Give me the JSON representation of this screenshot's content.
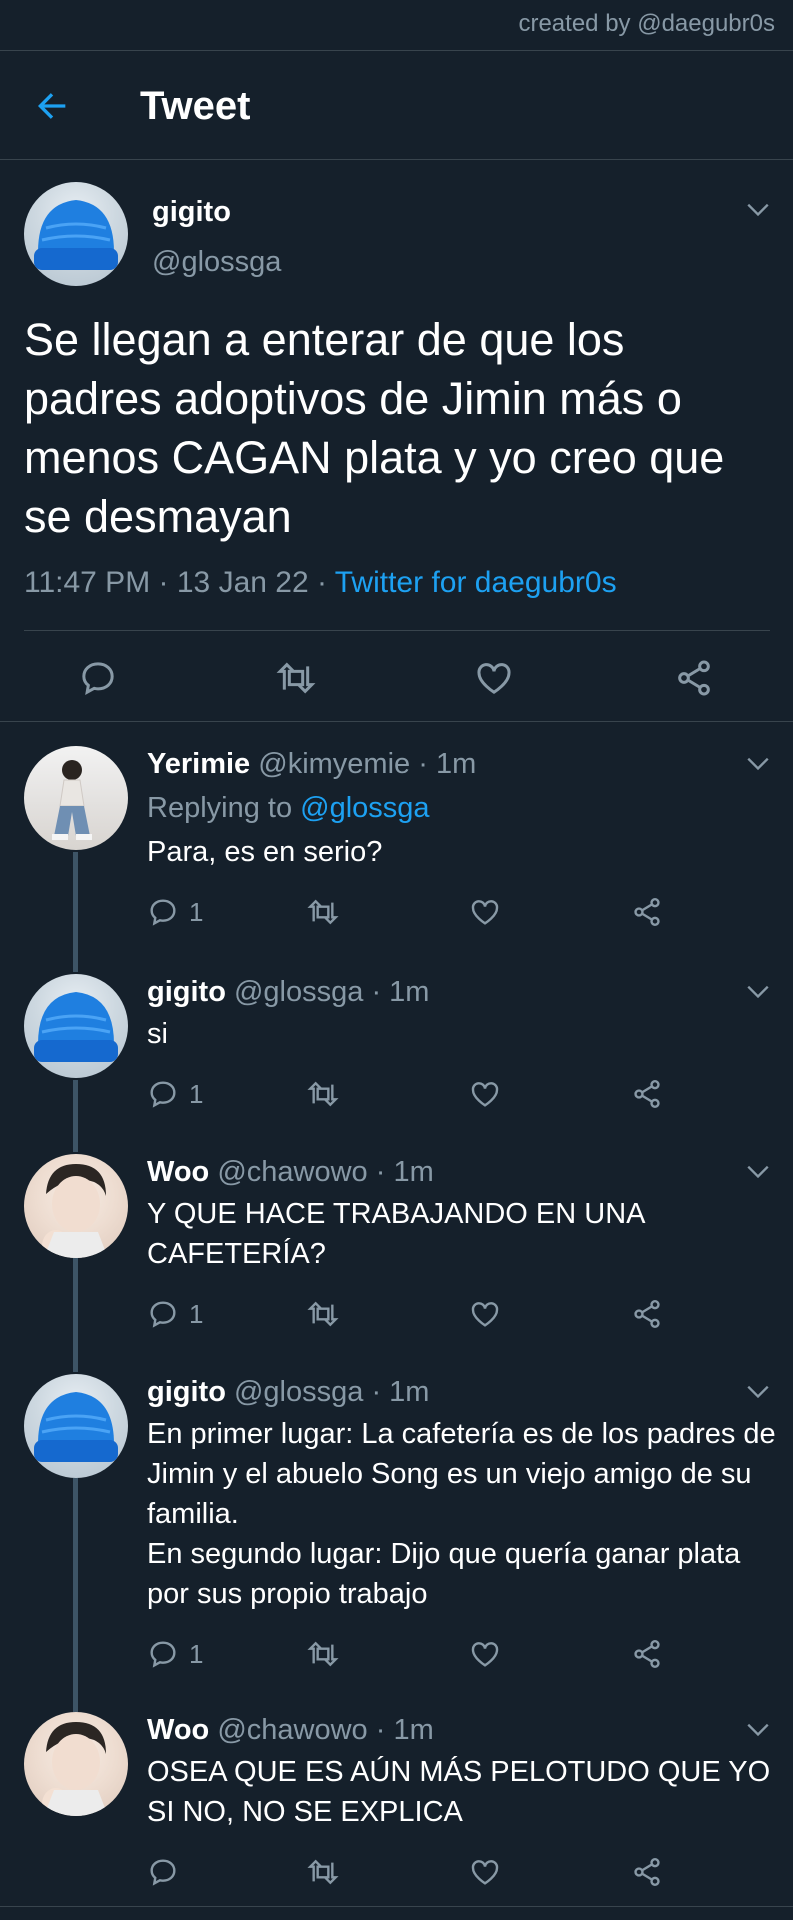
{
  "watermark": "created by @daegubr0s",
  "header": {
    "title": "Tweet",
    "back_icon": "arrow-left-icon"
  },
  "colors": {
    "background": "#15202b",
    "accent": "#1da1f2",
    "muted": "#8899a6",
    "divider": "#38444d"
  },
  "main_tweet": {
    "name": "gigito",
    "handle": "@glossga",
    "text": "Se llegan a enterar de que los padres adoptivos de Jimin más o menos CAGAN plata y yo creo que se desmayan",
    "time": "11:47 PM",
    "date": "13 Jan 22",
    "source": "Twitter for daegubr0s",
    "dot": " · "
  },
  "replies": [
    {
      "name": "Yerimie",
      "handle": "@kimyemie",
      "time": "1m",
      "replying_label": "Replying to ",
      "replying_to": "@glossga",
      "text": "Para, es en serio?",
      "reply_count": "1"
    },
    {
      "name": "gigito",
      "handle": "@glossga",
      "time": "1m",
      "text": "si",
      "reply_count": "1"
    },
    {
      "name": "Woo",
      "handle": "@chawowo",
      "time": "1m",
      "text": "Y QUE HACE TRABAJANDO EN UNA CAFETERÍA?",
      "reply_count": "1"
    },
    {
      "name": "gigito",
      "handle": "@glossga",
      "time": "1m",
      "text": "En primer lugar: La cafetería es de los padres de Jimin y el abuelo Song es un viejo amigo de su familia.\nEn segundo lugar: Dijo que quería ganar plata por sus propio trabajo",
      "reply_count": "1"
    },
    {
      "name": "Woo",
      "handle": "@chawowo",
      "time": "1m",
      "text": "OSEA QUE ES AÚN MÁS PELOTUDO QUE YO SI NO, NO SE EXPLICA",
      "reply_count": ""
    }
  ]
}
